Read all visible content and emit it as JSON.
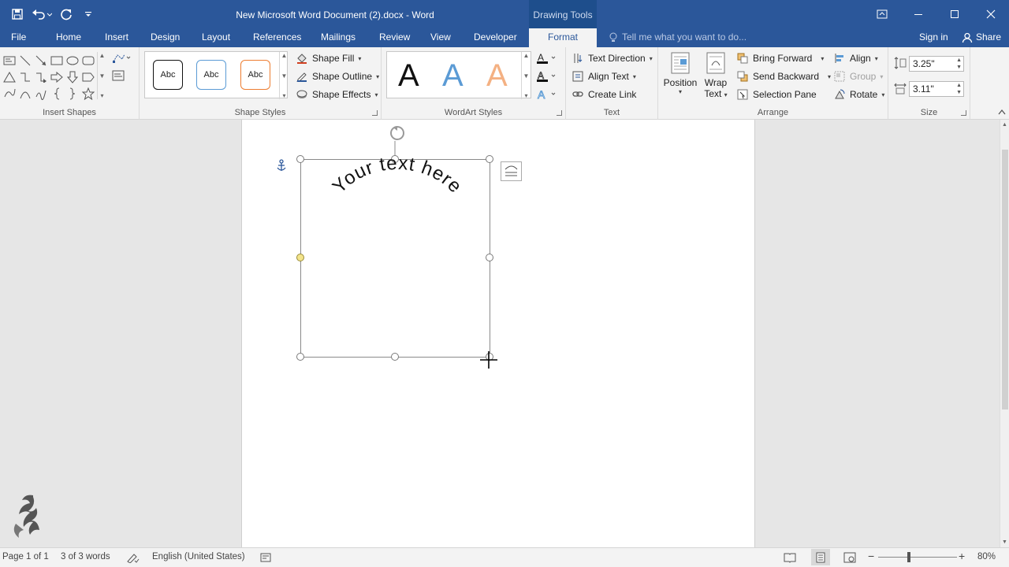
{
  "window": {
    "title": "New Microsoft Word Document (2).docx - Word",
    "contextual_tab_group": "Drawing Tools"
  },
  "tabs": {
    "file": "File",
    "home": "Home",
    "insert": "Insert",
    "design": "Design",
    "layout": "Layout",
    "references": "References",
    "mailings": "Mailings",
    "review": "Review",
    "view": "View",
    "developer": "Developer",
    "format": "Format"
  },
  "tell_me": "Tell me what you want to do...",
  "sign_in": "Sign in",
  "share": "Share",
  "ribbon": {
    "insert_shapes": {
      "label": "Insert Shapes"
    },
    "shape_styles": {
      "label": "Shape Styles",
      "gallery": [
        "Abc",
        "Abc",
        "Abc"
      ],
      "shape_fill": "Shape Fill",
      "shape_outline": "Shape Outline",
      "shape_effects": "Shape Effects"
    },
    "wordart_styles": {
      "label": "WordArt Styles",
      "gallery": [
        "A",
        "A",
        "A"
      ],
      "colors": {
        "black": "#111111",
        "blue": "#5b9bd5",
        "orange": "#f4b183"
      }
    },
    "text": {
      "label": "Text",
      "text_direction": "Text Direction",
      "align_text": "Align Text",
      "create_link": "Create Link"
    },
    "arrange": {
      "label": "Arrange",
      "position": "Position",
      "wrap_text": "Wrap Text",
      "bring_forward": "Bring Forward",
      "send_backward": "Send Backward",
      "selection_pane": "Selection Pane",
      "align": "Align",
      "group": "Group",
      "rotate": "Rotate"
    },
    "size": {
      "label": "Size",
      "height": "3.25\"",
      "width": "3.11\""
    }
  },
  "document": {
    "wordart_text": "Your text here"
  },
  "statusbar": {
    "page": "Page 1 of 1",
    "words": "3 of 3 words",
    "language": "English (United States)",
    "zoom": "80%"
  },
  "colors": {
    "accent": "#2b579a",
    "ribbon": "#f3f3f3",
    "canvas": "#e6e6e6"
  }
}
